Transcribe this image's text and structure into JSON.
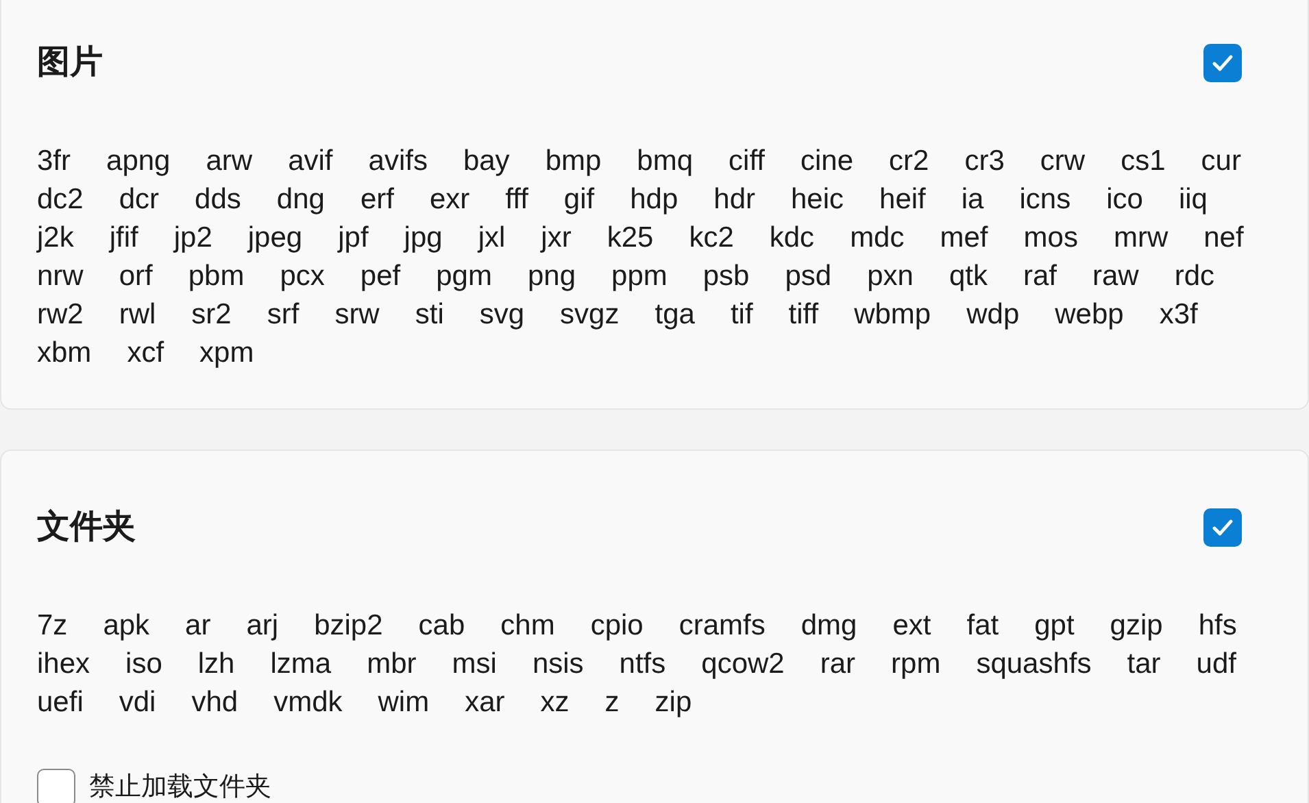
{
  "sections": [
    {
      "title": "图片",
      "checked": true,
      "extensions": [
        "3fr",
        "apng",
        "arw",
        "avif",
        "avifs",
        "bay",
        "bmp",
        "bmq",
        "ciff",
        "cine",
        "cr2",
        "cr3",
        "crw",
        "cs1",
        "cur",
        "dc2",
        "dcr",
        "dds",
        "dng",
        "erf",
        "exr",
        "fff",
        "gif",
        "hdp",
        "hdr",
        "heic",
        "heif",
        "ia",
        "icns",
        "ico",
        "iiq",
        "j2k",
        "jfif",
        "jp2",
        "jpeg",
        "jpf",
        "jpg",
        "jxl",
        "jxr",
        "k25",
        "kc2",
        "kdc",
        "mdc",
        "mef",
        "mos",
        "mrw",
        "nef",
        "nrw",
        "orf",
        "pbm",
        "pcx",
        "pef",
        "pgm",
        "png",
        "ppm",
        "psb",
        "psd",
        "pxn",
        "qtk",
        "raf",
        "raw",
        "rdc",
        "rw2",
        "rwl",
        "sr2",
        "srf",
        "srw",
        "sti",
        "svg",
        "svgz",
        "tga",
        "tif",
        "tiff",
        "wbmp",
        "wdp",
        "webp",
        "x3f",
        "xbm",
        "xcf",
        "xpm"
      ]
    },
    {
      "title": "文件夹",
      "checked": true,
      "extensions": [
        "7z",
        "apk",
        "ar",
        "arj",
        "bzip2",
        "cab",
        "chm",
        "cpio",
        "cramfs",
        "dmg",
        "ext",
        "fat",
        "gpt",
        "gzip",
        "hfs",
        "ihex",
        "iso",
        "lzh",
        "lzma",
        "mbr",
        "msi",
        "nsis",
        "ntfs",
        "qcow2",
        "rar",
        "rpm",
        "squashfs",
        "tar",
        "udf",
        "uefi",
        "vdi",
        "vhd",
        "vmdk",
        "wim",
        "xar",
        "xz",
        "z",
        "zip"
      ],
      "option": {
        "label": "禁止加载文件夹",
        "checked": false
      }
    }
  ]
}
